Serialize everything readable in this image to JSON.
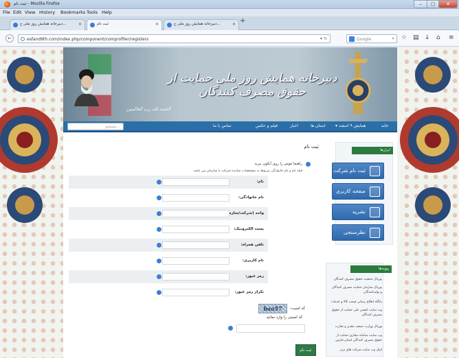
{
  "window": {
    "title": "ثبت نام - Mozilla Firefox",
    "controls": {
      "minimize": "–",
      "maximize": "▢",
      "close": "✕"
    }
  },
  "menu": [
    "File",
    "Edit",
    "View",
    "History",
    "Bookmarks",
    "Tools",
    "Help"
  ],
  "tabs": [
    {
      "label": "دبیرخانه همایش روز ملی ح...",
      "active": false
    },
    {
      "label": "ثبت نام",
      "active": true
    },
    {
      "label": "دبیرخانه همایش روز ملی ح...",
      "active": false
    }
  ],
  "nav": {
    "url": "esfand9th.com/index.php/component/comprofiler/registers",
    "search_engine": "Google",
    "search_placeholder": "Google"
  },
  "banner": {
    "title": "دبیرخانه همایش روز ملی حمایت از حقوق مصرف کنندگان",
    "signature": "الحمد لله رب العالمین"
  },
  "main_menu": {
    "items": [
      "خانه",
      "همایش ۹ اسفند ▾",
      "استان ها",
      "اخبار",
      "فیلم و عکس",
      "تماس با ما"
    ],
    "search_placeholder": "جستجو..."
  },
  "sidebar": {
    "tools_heading": "ابزارها",
    "buttons": [
      "ثبت نام شرکت ها",
      "صفحه کاربری",
      "نشریه",
      "نظرسنجی"
    ],
    "links_heading": "پیوندها",
    "links": [
      "پورتال جمعیت حقوق مصرف کنندگان",
      "پورتال سازمان حمایت مصرف کنندگان و تولیدکنندگان",
      "پایگاه اطلاع رسانی قیمت کالا و خدمات",
      "وب سایت انجمن ملی حمایت از حقوق مصرف کنندگان",
      "پورتال وزارت صنعت معدن و تجارت",
      "وب سایت سامانه مجازی حمایت از حقوق مصرف کنندگان استان فارس",
      "لینک وب سایت شرکت های برتر"
    ]
  },
  "form": {
    "title": "ثبت نام",
    "guide": "راهنما موس را روی آیکون ببرید",
    "note": "فیلد نام و نام خانوادگی مربوط به مشخصات نماینده شرکت یا سازمان می باشد.",
    "fields": [
      {
        "label": "نام:",
        "value": ""
      },
      {
        "label": "نام خانوادگی:",
        "value": ""
      },
      {
        "label": "واحد (شرکت/سازمان):",
        "value": ""
      },
      {
        "label": "پست الکترونیک:",
        "value": ""
      },
      {
        "label": "تلفن همراه:",
        "value": ""
      },
      {
        "label": "نام کاربری:",
        "value": ""
      },
      {
        "label": "رمز عبور:",
        "value": ""
      },
      {
        "label": "تکرار رمز عبور:",
        "value": ""
      }
    ],
    "captcha_label": "کد امنیت:",
    "captcha_code": "baa57",
    "captcha_prompt": "کد امنیتی را وارد نمائید",
    "submit": "ثبت نام"
  }
}
